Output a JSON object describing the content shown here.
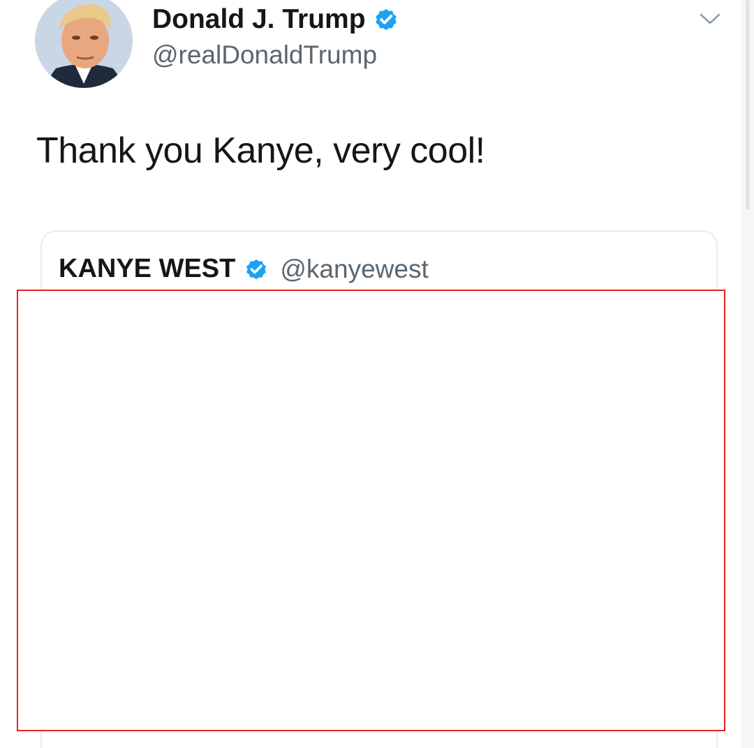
{
  "tweet": {
    "author": {
      "display_name": "Donald J. Trump",
      "handle": "@realDonaldTrump",
      "verified": true
    },
    "text": "Thank you Kanye, very cool!",
    "menu_icon": "chevron-down-icon"
  },
  "quoted_tweet": {
    "display_name": "KANYE WEST",
    "handle": "@kanyewest",
    "verified": true
  },
  "colors": {
    "verified_blue": "#1da1f2",
    "text_primary": "#14171a",
    "text_secondary": "#5a6670",
    "outline_red": "#e02424"
  }
}
